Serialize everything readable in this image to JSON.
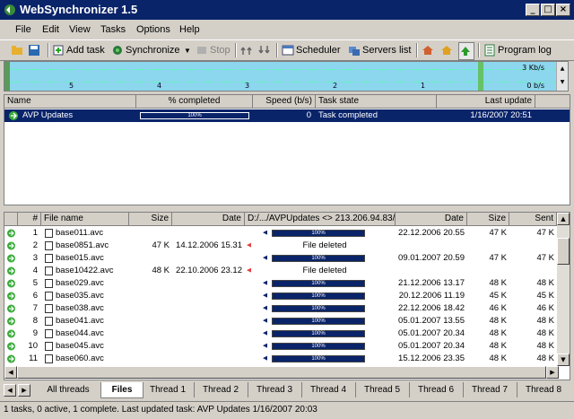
{
  "window": {
    "title": "WebSynchronizer 1.5"
  },
  "menu": [
    "File",
    "Edit",
    "View",
    "Tasks",
    "Options",
    "Help"
  ],
  "toolbar": {
    "add_task": "Add task",
    "synchronize": "Synchronize",
    "stop": "Stop",
    "scheduler": "Scheduler",
    "servers_list": "Servers list",
    "program_log": "Program log"
  },
  "graph": {
    "kbs_top": "3 Kb/s",
    "kbs_bottom": "0 b/s",
    "ticks": [
      "5",
      "4",
      "3",
      "2",
      "1"
    ]
  },
  "tasks": {
    "headers": [
      "Name",
      "% completed",
      "Speed (b/s)",
      "Task state",
      "Last update"
    ],
    "rows": [
      {
        "name": "AVP Updates",
        "percent": "100%",
        "percent_value": 100,
        "speed": "0",
        "state": "Task completed",
        "last_update": "1/16/2007 20:51"
      }
    ]
  },
  "files": {
    "headers": [
      "#",
      "File name",
      "Size",
      "Date",
      "D:/.../AVPUpdates <> 213.206.94.83/...",
      "Date",
      "Size",
      "Sent"
    ],
    "rows": [
      {
        "n": "1",
        "name": "base011.avc",
        "size": "",
        "date": "",
        "progress": "100%",
        "progress_value": 100,
        "rdate": "22.12.2006  20.55",
        "rsize": "47 K",
        "sent": "47 K"
      },
      {
        "n": "2",
        "name": "base0851.avc",
        "size": "47 K",
        "date": "14.12.2006  15.31",
        "status": "File deleted",
        "rdate": "",
        "rsize": "",
        "sent": ""
      },
      {
        "n": "3",
        "name": "base015.avc",
        "size": "",
        "date": "",
        "progress": "100%",
        "progress_value": 100,
        "rdate": "09.01.2007  20.59",
        "rsize": "47 K",
        "sent": "47 K"
      },
      {
        "n": "4",
        "name": "base10422.avc",
        "size": "48 K",
        "date": "22.10.2006  23.12",
        "status": "File deleted",
        "rdate": "",
        "rsize": "",
        "sent": ""
      },
      {
        "n": "5",
        "name": "base029.avc",
        "size": "",
        "date": "",
        "progress": "100%",
        "progress_value": 100,
        "rdate": "21.12.2006  13.17",
        "rsize": "48 K",
        "sent": "48 K"
      },
      {
        "n": "6",
        "name": "base035.avc",
        "size": "",
        "date": "",
        "progress": "100%",
        "progress_value": 100,
        "rdate": "20.12.2006  11.19",
        "rsize": "45 K",
        "sent": "45 K"
      },
      {
        "n": "7",
        "name": "base038.avc",
        "size": "",
        "date": "",
        "progress": "100%",
        "progress_value": 100,
        "rdate": "22.12.2006  18.42",
        "rsize": "46 K",
        "sent": "46 K"
      },
      {
        "n": "8",
        "name": "base041.avc",
        "size": "",
        "date": "",
        "progress": "100%",
        "progress_value": 100,
        "rdate": "05.01.2007  13.55",
        "rsize": "48 K",
        "sent": "48 K"
      },
      {
        "n": "9",
        "name": "base044.avc",
        "size": "",
        "date": "",
        "progress": "100%",
        "progress_value": 100,
        "rdate": "05.01.2007  20.34",
        "rsize": "48 K",
        "sent": "48 K"
      },
      {
        "n": "10",
        "name": "base045.avc",
        "size": "",
        "date": "",
        "progress": "100%",
        "progress_value": 100,
        "rdate": "05.01.2007  20.34",
        "rsize": "48 K",
        "sent": "48 K"
      },
      {
        "n": "11",
        "name": "base060.avc",
        "size": "",
        "date": "",
        "progress": "100%",
        "progress_value": 100,
        "rdate": "15.12.2006  23.35",
        "rsize": "48 K",
        "sent": "48 K"
      }
    ]
  },
  "tabs": [
    "All threads",
    "Files",
    "Thread 1",
    "Thread 2",
    "Thread 3",
    "Thread 4",
    "Thread 5",
    "Thread 6",
    "Thread 7",
    "Thread 8"
  ],
  "active_tab": "Files",
  "status": "1 tasks, 0 active, 1 complete. Last updated task: AVP Updates 1/16/2007 20:03",
  "colors": {
    "titlebar": "#0a246a",
    "progress": "#0a246a",
    "graph": "#8cd6ee"
  }
}
